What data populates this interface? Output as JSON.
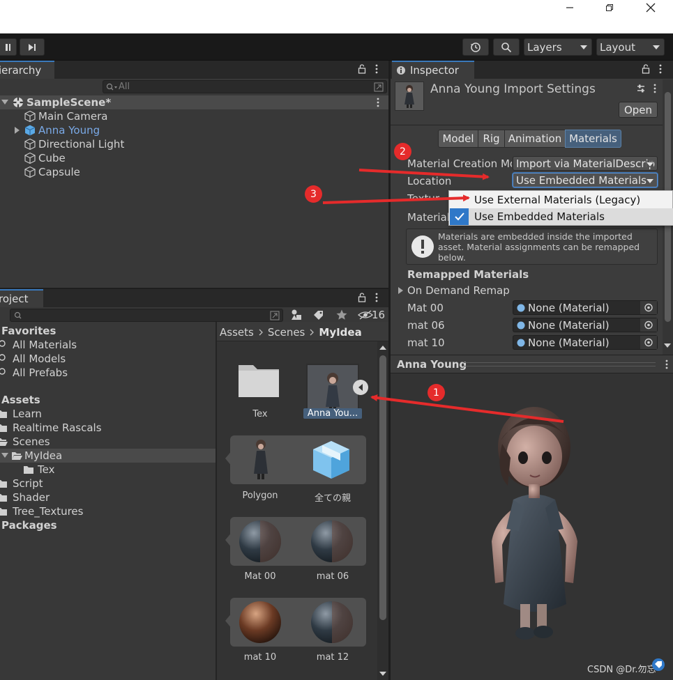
{
  "window": {
    "minimize": "—",
    "maximize": "❐",
    "close": "✕"
  },
  "toolbar": {
    "layers_label": "Layers",
    "layout_label": "Layout"
  },
  "hierarchy": {
    "tab_label": "ierarchy",
    "search_placeholder": "All",
    "scene_name": "SampleScene*",
    "items": [
      {
        "label": "Main Camera"
      },
      {
        "label": "Anna Young"
      },
      {
        "label": "Directional Light"
      },
      {
        "label": "Cube"
      },
      {
        "label": "Capsule"
      }
    ]
  },
  "project": {
    "tab_label": "roject",
    "hidden_count": "16",
    "breadcrumb": {
      "root": "Assets",
      "mid": "Scenes",
      "current": "MyIdea"
    },
    "favorites": {
      "title": "Favorites",
      "items": [
        "All Materials",
        "All Models",
        "All Prefabs"
      ]
    },
    "assets": {
      "title": "Assets",
      "items": [
        "Learn",
        "Realtime Rascals",
        "Scenes",
        "MyIdea",
        "Tex",
        "Script",
        "Shader",
        "Tree_Textures"
      ]
    },
    "packages_title": "Packages",
    "grid": {
      "tex": "Tex",
      "anna": "Anna You...",
      "polygon": "Polygon",
      "allparent": "全ての親",
      "mat00": "Mat 00",
      "mat06": "mat 06",
      "mat10": "mat 10",
      "mat12": "mat 12"
    }
  },
  "inspector": {
    "tab_label": "Inspector",
    "title": "Anna Young Import Settings",
    "open_label": "Open",
    "tabs": [
      "Model",
      "Rig",
      "Animation",
      "Materials"
    ],
    "material_creation_label": "Material Creation Mo",
    "material_creation_value": "Import via MaterialDescrip",
    "location_label": "Location",
    "location_value": "Use Embedded Materials",
    "textures_label": "Textur",
    "materials_label": "Material",
    "info_text": "Materials are embedded inside the imported asset. Material assignments can be remapped below.",
    "remapped_title": "Remapped Materials",
    "on_demand_label": "On Demand Remap",
    "remaps": [
      {
        "name": "Mat 00",
        "value": "None (Material)"
      },
      {
        "name": "mat 06",
        "value": "None (Material)"
      },
      {
        "name": "mat 10",
        "value": "None (Material)"
      }
    ]
  },
  "location_menu": {
    "items": [
      {
        "label": "Use External Materials (Legacy)",
        "checked": false
      },
      {
        "label": "Use Embedded Materials",
        "checked": true
      }
    ]
  },
  "preview": {
    "title": "Anna Young"
  },
  "annotations": {
    "one": "1",
    "two": "2",
    "three": "3",
    "color": "#e52b2b"
  },
  "watermark": "CSDN @Dr.勿忘"
}
